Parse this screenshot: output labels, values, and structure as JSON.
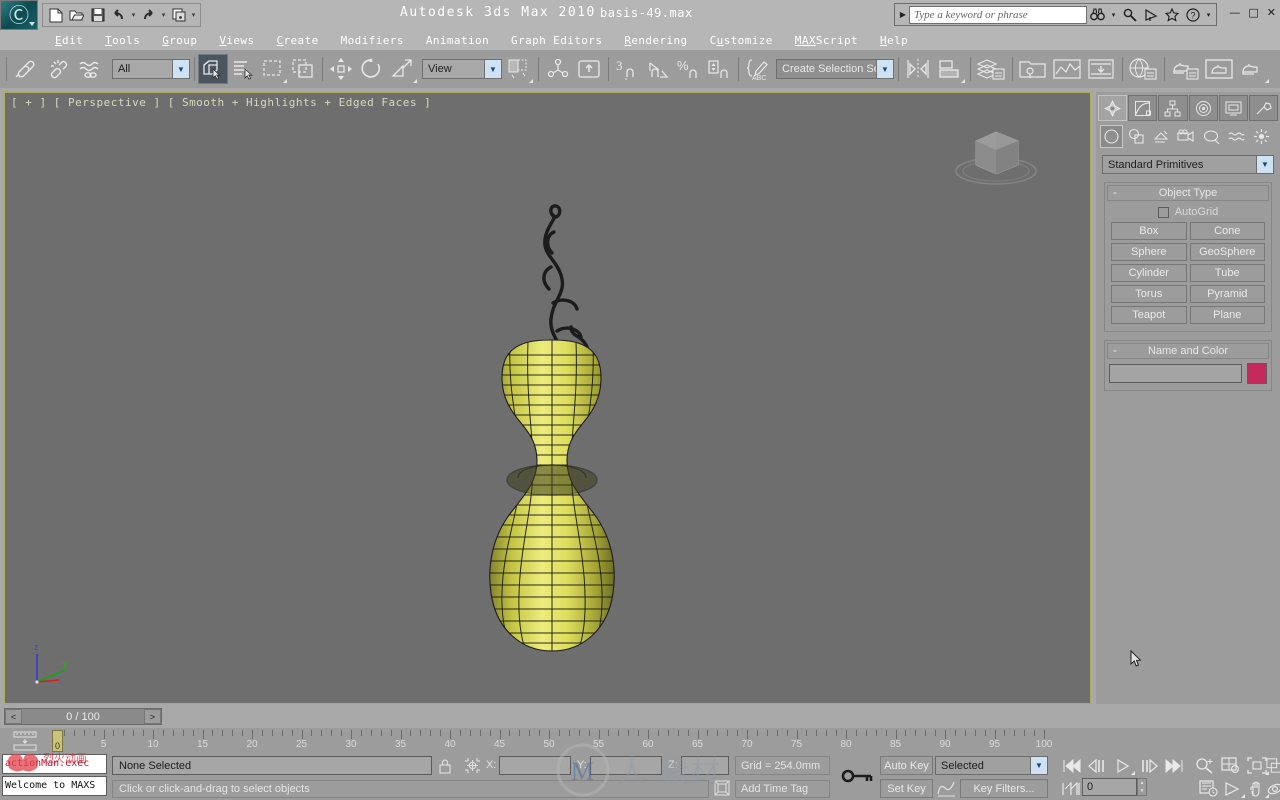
{
  "window": {
    "app_title": "Autodesk 3ds Max  2010",
    "file_title": "basis-49.max",
    "minimize": "—",
    "maximize": "□",
    "close": "✕"
  },
  "quick_access": {
    "items": [
      {
        "name": "new-file-icon",
        "glyph": "□"
      },
      {
        "name": "open-file-icon",
        "glyph": "⌲"
      },
      {
        "name": "save-file-icon",
        "glyph": "▣"
      },
      {
        "name": "undo-icon",
        "glyph": "↶"
      },
      {
        "name": "undo-dropdown-icon",
        "glyph": "▾"
      },
      {
        "name": "redo-icon",
        "glyph": "↷"
      },
      {
        "name": "redo-dropdown-icon",
        "glyph": "▾"
      },
      {
        "name": "project-folder-icon",
        "glyph": "☰"
      },
      {
        "name": "customize-qat-icon",
        "glyph": "▾"
      }
    ]
  },
  "search": {
    "placeholder": "Type a keyword or phrase",
    "expand_glyph": "▶",
    "icons": [
      {
        "name": "binoculars-icon",
        "glyph": "∞"
      },
      {
        "name": "binoculars-dropdown-icon",
        "glyph": "▾"
      },
      {
        "name": "magnifier-icon",
        "glyph": "🔍"
      },
      {
        "name": "communication-center-icon",
        "glyph": "☄"
      },
      {
        "name": "favorites-star-icon",
        "glyph": "☆"
      },
      {
        "name": "help-icon",
        "glyph": "?"
      },
      {
        "name": "help-dropdown-icon",
        "glyph": "▾"
      }
    ]
  },
  "menu": {
    "items": [
      {
        "label": "Edit",
        "mnemonic": "E"
      },
      {
        "label": "Tools",
        "mnemonic": "T"
      },
      {
        "label": "Group",
        "mnemonic": "G"
      },
      {
        "label": "Views",
        "mnemonic": "V"
      },
      {
        "label": "Create",
        "mnemonic": "C"
      },
      {
        "label": "Modifiers",
        "mnemonic": ""
      },
      {
        "label": "Animation",
        "mnemonic": ""
      },
      {
        "label": "Graph Editors",
        "mnemonic": ""
      },
      {
        "label": "Rendering",
        "mnemonic": "R"
      },
      {
        "label": "Customize",
        "mnemonic": "u"
      },
      {
        "label": "MAXScript",
        "mnemonic": "MAX"
      },
      {
        "label": "Help",
        "mnemonic": "H"
      }
    ]
  },
  "toolbar": {
    "selection_filter": "All",
    "reference_coord_system": "View",
    "named_selection_sets": "Create Selection Set",
    "angle_snap_value": "3",
    "buttons": [
      {
        "name": "select-and-link-icon"
      },
      {
        "name": "unlink-selection-icon"
      },
      {
        "name": "bind-to-space-warp-icon"
      },
      {
        "name": "select-object-icon"
      },
      {
        "name": "select-by-name-icon"
      },
      {
        "name": "selection-region-icon"
      },
      {
        "name": "window-crossing-icon"
      },
      {
        "name": "select-and-move-icon"
      },
      {
        "name": "select-and-rotate-icon"
      },
      {
        "name": "select-and-scale-icon"
      },
      {
        "name": "use-center-flyout-icon"
      },
      {
        "name": "select-and-manipulate-icon"
      },
      {
        "name": "snaps-toggle-icon"
      },
      {
        "name": "angle-snap-toggle-icon"
      },
      {
        "name": "percent-snap-toggle-icon"
      },
      {
        "name": "spinner-snap-toggle-icon"
      },
      {
        "name": "edit-named-selection-sets-icon"
      },
      {
        "name": "mirror-icon"
      },
      {
        "name": "align-icon"
      },
      {
        "name": "layer-manager-icon"
      },
      {
        "name": "curve-editor-icon"
      },
      {
        "name": "schematic-view-icon"
      },
      {
        "name": "material-editor-icon"
      },
      {
        "name": "render-setup-icon"
      },
      {
        "name": "rendered-frame-window-icon"
      },
      {
        "name": "render-production-icon"
      }
    ]
  },
  "viewport": {
    "label": "[ + ] [ Perspective ] [ Smooth + Highlights + Edged Faces ]",
    "axis": {
      "z": "z",
      "y": "y",
      "x": "x"
    },
    "background_color": "#6e6e6e",
    "object_color": "#d8d84a",
    "border_color": "#b3aa62"
  },
  "command_panel": {
    "tabs": [
      {
        "name": "create-tab",
        "selected": true
      },
      {
        "name": "modify-tab",
        "selected": false
      },
      {
        "name": "hierarchy-tab",
        "selected": false
      },
      {
        "name": "motion-tab",
        "selected": false
      },
      {
        "name": "display-tab",
        "selected": false
      },
      {
        "name": "utilities-tab",
        "selected": false
      }
    ],
    "categories": [
      {
        "name": "geometry-category",
        "selected": true
      },
      {
        "name": "shapes-category",
        "selected": false
      },
      {
        "name": "lights-category",
        "selected": false
      },
      {
        "name": "cameras-category",
        "selected": false
      },
      {
        "name": "helpers-category",
        "selected": false
      },
      {
        "name": "space-warps-category",
        "selected": false
      },
      {
        "name": "systems-category",
        "selected": false
      }
    ],
    "subcategory": "Standard Primitives",
    "object_type": {
      "title": "Object Type",
      "autogrid_label": "AutoGrid",
      "autogrid_checked": false,
      "buttons": [
        "Box",
        "Cone",
        "Sphere",
        "GeoSphere",
        "Cylinder",
        "Tube",
        "Torus",
        "Pyramid",
        "Teapot",
        "Plane"
      ]
    },
    "name_and_color": {
      "title": "Name and Color",
      "name_value": "",
      "color": "#c42a5c"
    },
    "collapse_glyph": "-"
  },
  "timebar": {
    "current_frame_display": "0 / 100",
    "prev_glyph": "<",
    "next_glyph": ">",
    "slider_label": "0",
    "ruler_max": 100,
    "ruler_labels": [
      5,
      10,
      15,
      20,
      25,
      30,
      35,
      40,
      45,
      50,
      55,
      60,
      65,
      70,
      75,
      80,
      85,
      90,
      95,
      100
    ]
  },
  "statusbar": {
    "listener_line1": "actionMan.exec",
    "listener_line2": "Welcome to MAXS",
    "selection_status": "None Selected",
    "prompt": "Click or click-and-drag to select objects",
    "lock_icon": "lock-selection-icon",
    "transform_icon": "absolute-relative-transform-icon",
    "coords": [
      {
        "label": "X:",
        "value": ""
      },
      {
        "label": "Y:",
        "value": ""
      },
      {
        "label": "Z:",
        "value": ""
      }
    ],
    "grid_text": "Grid = 254.0mm",
    "time_tag": "Add Time Tag",
    "key_mode_icon": "key-mode-toggle-icon",
    "auto_key": "Auto Key",
    "set_key": "Set Key",
    "key_filters": "Key Filters...",
    "selected_filter": "Selected",
    "frame_value": "0",
    "nav_buttons_row1": [
      {
        "name": "goto-start-icon",
        "glyph": "⏮"
      },
      {
        "name": "previous-frame-icon",
        "glyph": "◁❙"
      },
      {
        "name": "play-animation-icon",
        "glyph": "▷"
      },
      {
        "name": "next-frame-icon",
        "glyph": "❙▷"
      },
      {
        "name": "goto-end-icon",
        "glyph": "⏭"
      },
      {
        "name": "zoom-icon",
        "glyph": "⌕"
      },
      {
        "name": "zoom-all-icon",
        "glyph": "⊞"
      },
      {
        "name": "zoom-extents-icon",
        "glyph": "⬚"
      },
      {
        "name": "zoom-extents-all-icon",
        "glyph": "⧉"
      }
    ],
    "nav_buttons_row2": [
      {
        "name": "key-mode-toggle-icon",
        "glyph": "⏮"
      },
      {
        "name": "time-configuration-icon",
        "glyph": "⏱"
      },
      {
        "name": "field-of-view-icon",
        "glyph": "▷"
      },
      {
        "name": "pan-view-icon",
        "glyph": "✋"
      },
      {
        "name": "orbit-icon",
        "glyph": "⥁"
      },
      {
        "name": "maximize-viewport-toggle-icon",
        "glyph": "⬜"
      }
    ]
  },
  "colors": {
    "chrome": "#9c9c9c",
    "titlebar": "#b6b6b6",
    "viewport_bg": "#6e6e6e",
    "accent_blue": "#cfe2f3",
    "mesh_yellow": "#d8d84a",
    "name_color_swatch": "#c42a5c"
  }
}
